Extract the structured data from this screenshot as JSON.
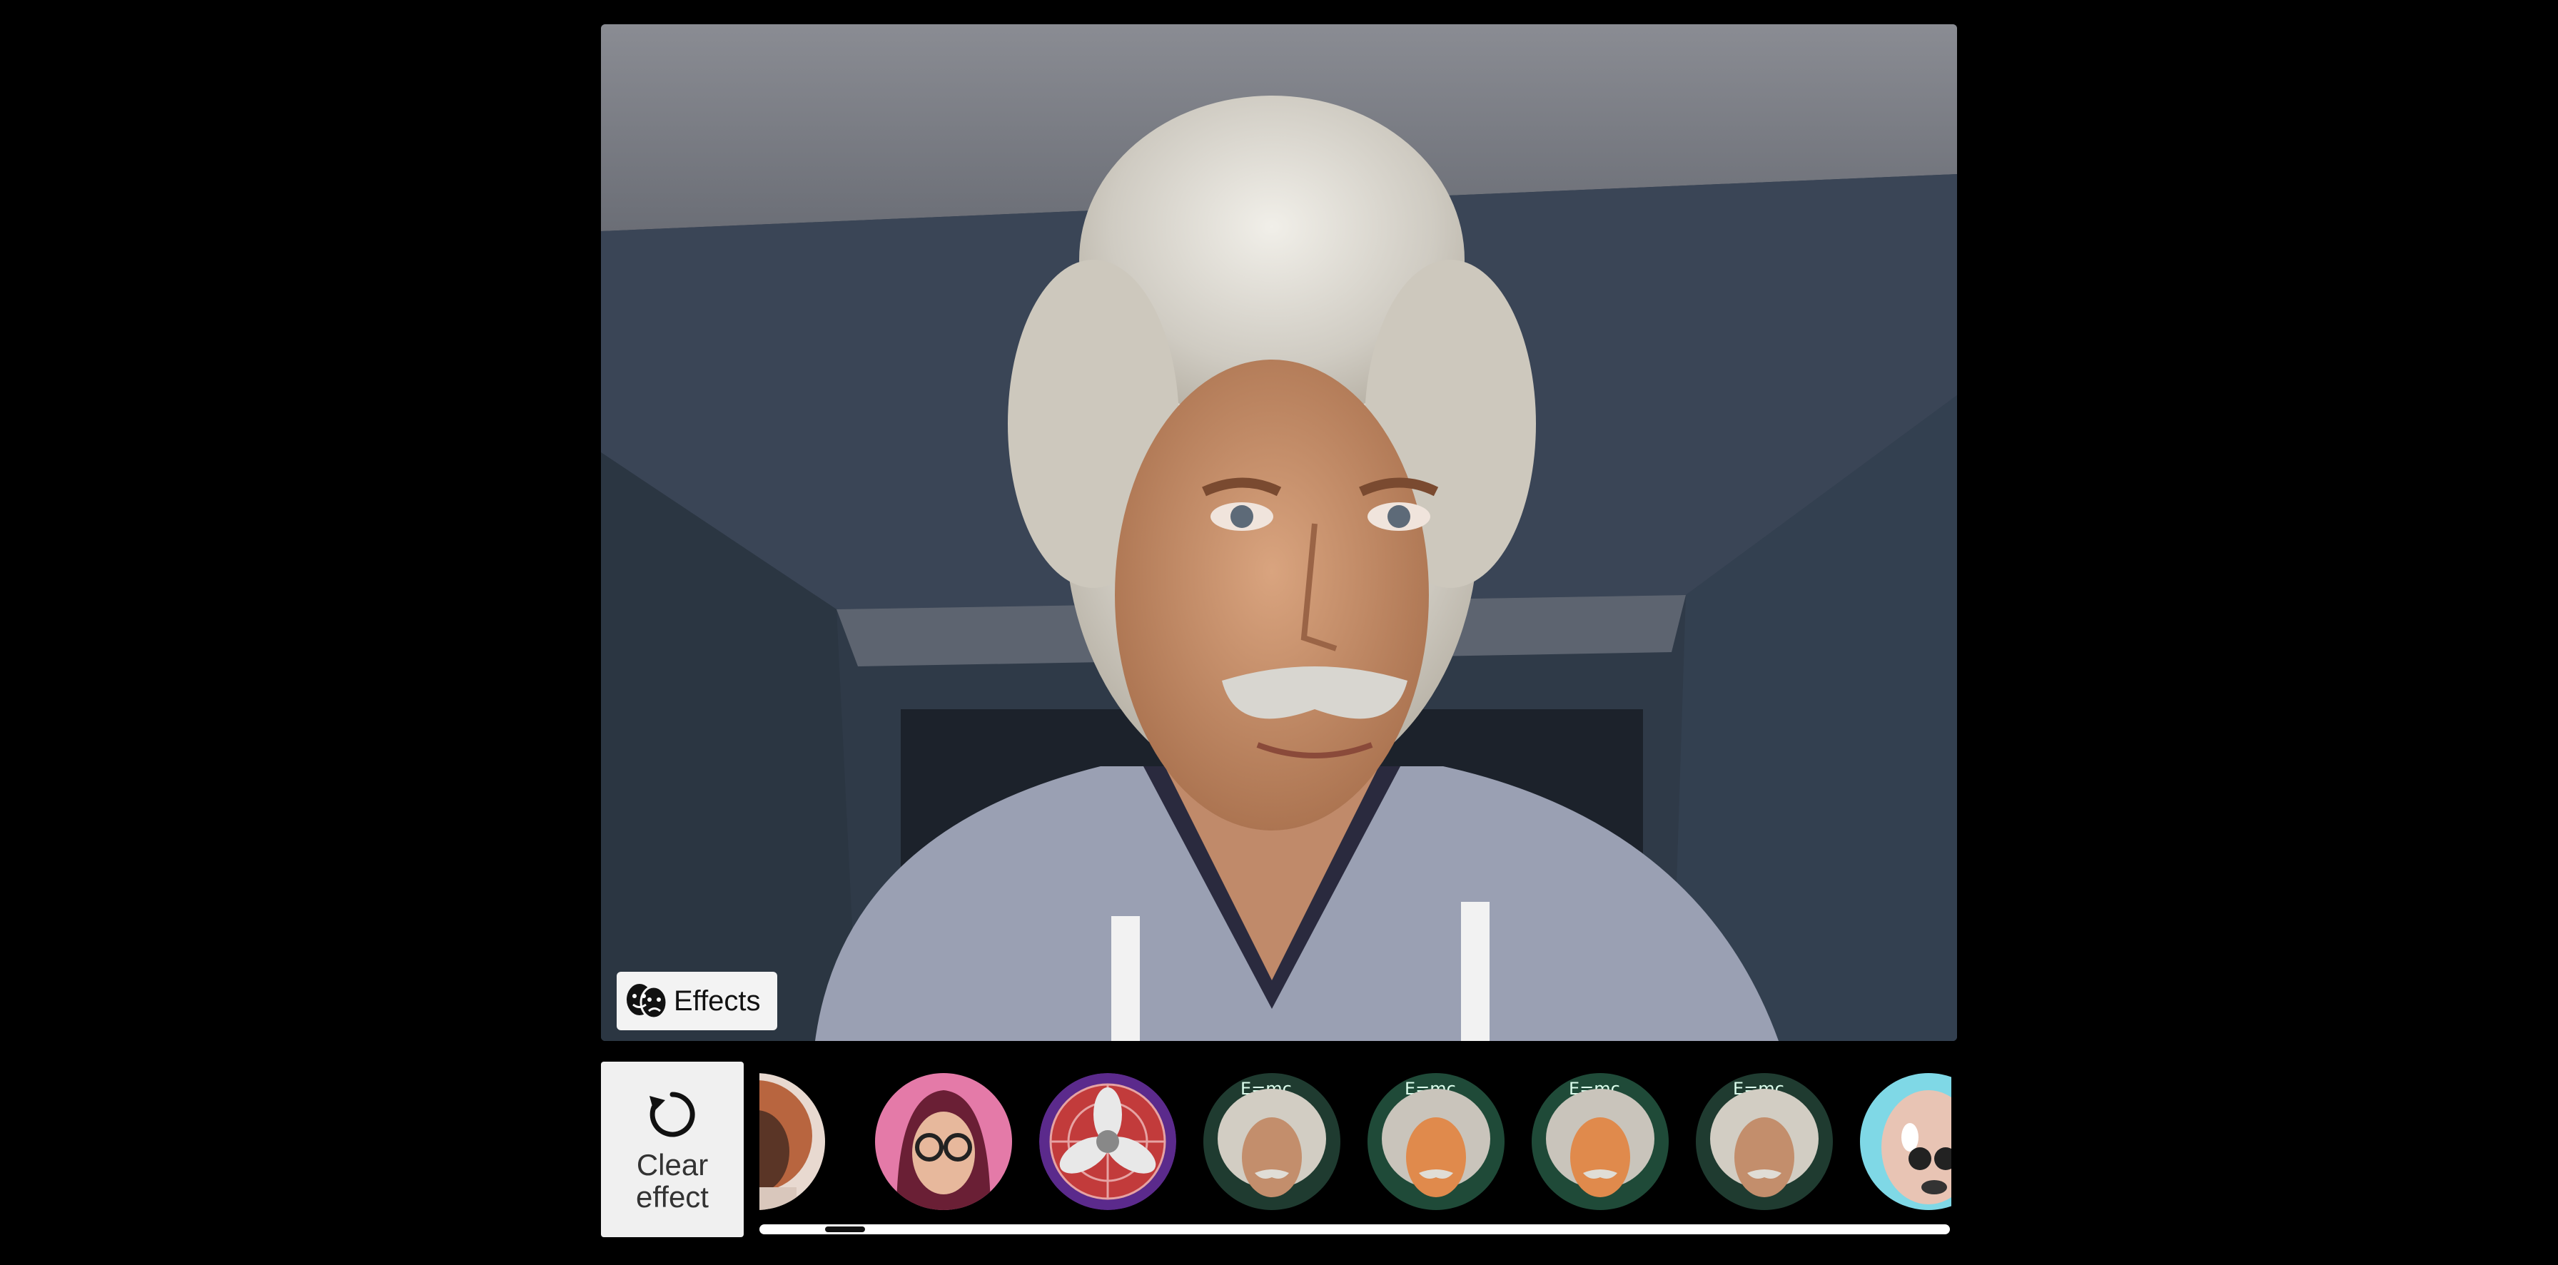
{
  "viewer": {
    "effects_label": "Effects",
    "effects_icon": "theater-masks-icon"
  },
  "tray": {
    "clear_label": "Clear effect",
    "clear_icon": "reset-icon",
    "effects": [
      {
        "name": "curly-hair-woman-effect",
        "icon": "portrait-curly-hair"
      },
      {
        "name": "headscarf-glasses-effect",
        "icon": "portrait-headscarf-glasses"
      },
      {
        "name": "fan-effect",
        "icon": "fan-icon"
      },
      {
        "name": "einstein-effect-1",
        "icon": "portrait-einstein",
        "text": "E=mc"
      },
      {
        "name": "einstein-effect-2",
        "icon": "portrait-einstein",
        "text": "E=mc"
      },
      {
        "name": "einstein-effect-3",
        "icon": "portrait-einstein",
        "text": "E=mc"
      },
      {
        "name": "einstein-effect-4",
        "icon": "portrait-einstein",
        "text": "E=mc"
      },
      {
        "name": "face-morph-effect",
        "icon": "portrait-face-morph"
      }
    ],
    "scroll_position": 0.04
  },
  "colors": {
    "background": "#000000",
    "button_bg": "#f0f0f0",
    "scrollbar": "#ffffff"
  }
}
